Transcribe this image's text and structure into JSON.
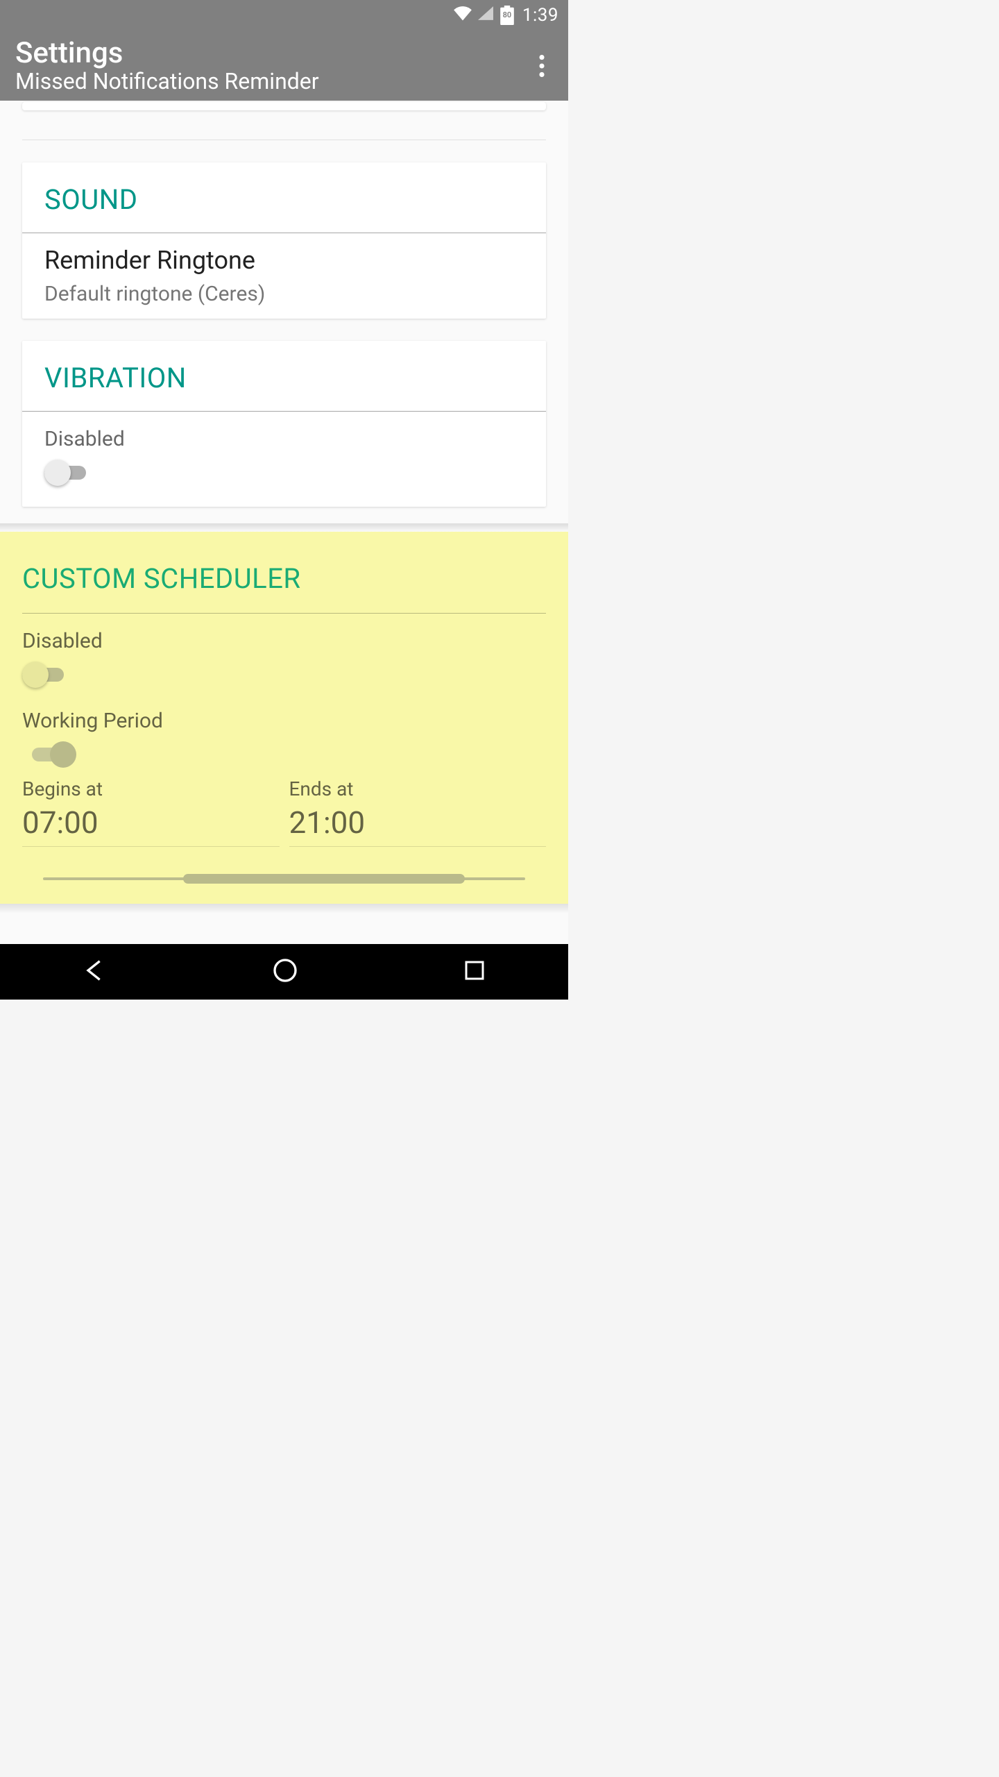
{
  "status": {
    "battery": "80",
    "time": "1:39"
  },
  "appbar": {
    "title": "Settings",
    "subtitle": "Missed Notifications Reminder"
  },
  "sound": {
    "header": "SOUND",
    "ringtone_title": "Reminder Ringtone",
    "ringtone_value": "Default ringtone (Ceres)"
  },
  "vibration": {
    "header": "VIBRATION",
    "status": "Disabled",
    "enabled": false
  },
  "scheduler": {
    "header": "CUSTOM SCHEDULER",
    "status": "Disabled",
    "enabled": false,
    "working_period_label": "Working Period",
    "working_period_on": true,
    "begins_label": "Begins at",
    "begins_value": "07:00",
    "ends_label": "Ends at",
    "ends_value": "21:00",
    "range_start_pct": 29,
    "range_end_pct": 87.5
  }
}
